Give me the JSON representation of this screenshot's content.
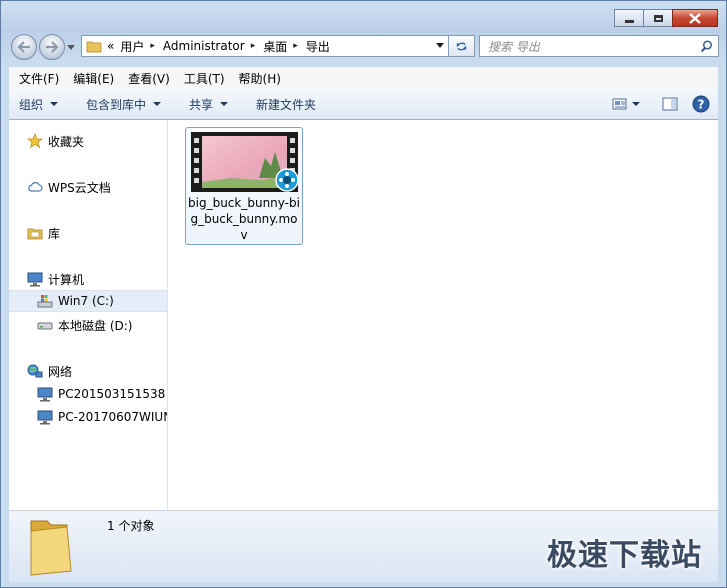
{
  "window": {
    "title_buttons": [
      "minimize",
      "maximize",
      "close"
    ]
  },
  "address": {
    "overflow": "«",
    "crumbs": [
      "用户",
      "Administrator",
      "桌面",
      "导出"
    ],
    "separator": "▸"
  },
  "search": {
    "placeholder": "搜索 导出"
  },
  "menu": [
    "文件(F)",
    "编辑(E)",
    "查看(V)",
    "工具(T)",
    "帮助(H)"
  ],
  "commands": [
    "组织",
    "包含到库中",
    "共享",
    "新建文件夹"
  ],
  "nav": {
    "favorites": "收藏夹",
    "wps": "WPS云文档",
    "libraries": "库",
    "computer": "计算机",
    "drive_c": "Win7 (C:)",
    "drive_d": "本地磁盘 (D:)",
    "network": "网络",
    "pc1": "PC201503151538",
    "pc2": "PC-20170607WIUN"
  },
  "file": {
    "name": "big_buck_bunny-big_buck_bunny.mov"
  },
  "status": {
    "count": "1 个对象"
  },
  "watermark": "极速下载站"
}
